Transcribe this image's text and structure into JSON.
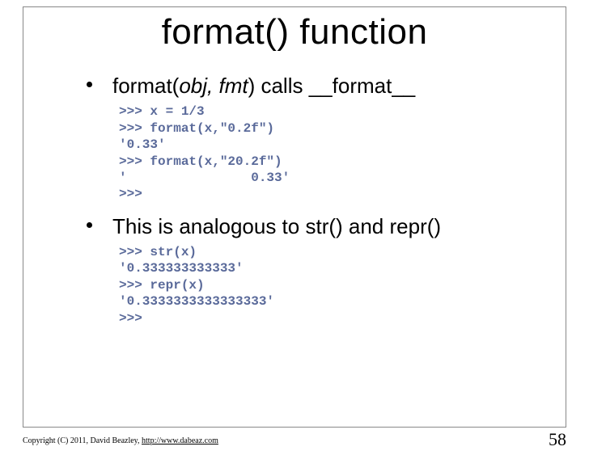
{
  "title": "format() function",
  "bullets": [
    {
      "prefix": "format(",
      "args": "obj, fmt",
      "suffix": ") calls __format__",
      "code": ">>> x = 1/3\n>>> format(x,\"0.2f\")\n'0.33'\n>>> format(x,\"20.2f\")\n'                0.33'\n>>>"
    },
    {
      "text": "This is analogous to str() and repr()",
      "code": ">>> str(x)\n'0.333333333333'\n>>> repr(x)\n'0.3333333333333333'\n>>>"
    }
  ],
  "footer": {
    "copyright": "Copyright (C) 2011, David Beazley, ",
    "url": "http://www.dabeaz.com"
  },
  "page_number": "58"
}
